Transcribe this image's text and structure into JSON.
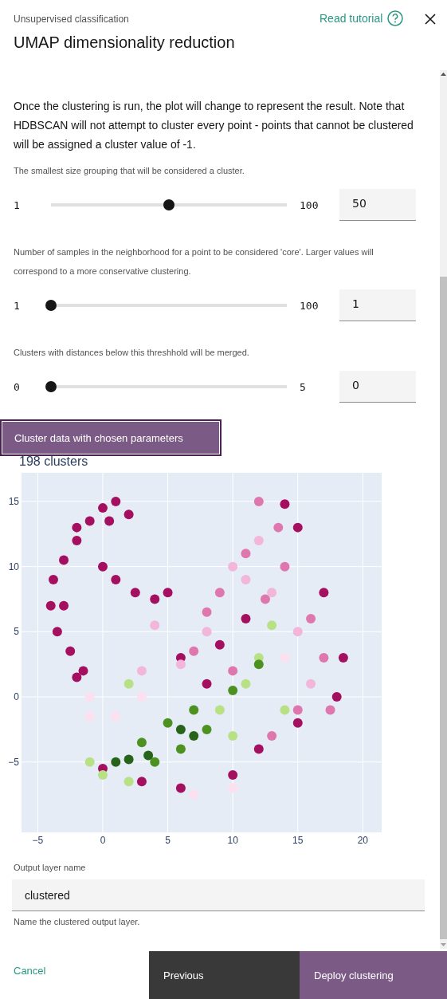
{
  "header": {
    "subtitle": "Unsupervised classification",
    "title": "UMAP dimensionality reduction",
    "tutorial_link": "Read tutorial"
  },
  "intro": "Once the clustering is run, the plot will change to represent the result. Note that HDBSCAN will not attempt to cluster every point - points that cannot be clustered will be assigned a cluster value of -1.",
  "parameters": [
    {
      "description": "The smallest size grouping that will be considered a cluster.",
      "min": "1",
      "max": "100",
      "level": 0.5,
      "value": "50"
    },
    {
      "description": "Number of samples in the neighborhood for a point to be considered 'core'. Larger values will correspond to a more conservative clustering.",
      "min": "1",
      "max": "100",
      "level": 0,
      "value": "1"
    },
    {
      "description": "Clusters with distances below this threshhold will be merged.",
      "min": "0",
      "max": "5",
      "level": 0,
      "value": "0"
    }
  ],
  "cluster_button": "Cluster data with chosen parameters",
  "plot": {
    "chart_data": {
      "type": "scatter",
      "title": "198 clusters",
      "xlim": [
        -6.25,
        21.45
      ],
      "ylim": [
        -10.4,
        17.2
      ],
      "xticks": [
        {
          "value": -5,
          "label": "−5"
        },
        0,
        5,
        10,
        15,
        20
      ],
      "yticks": [
        {
          "value": -5,
          "label": "−5"
        },
        0,
        5,
        10,
        15
      ],
      "grid": true,
      "series": [
        {
          "color": "#a50f5f",
          "x": [
            1,
            0,
            -1,
            -2,
            -3,
            -3.8,
            -4,
            -3.5,
            -2.5,
            -1.5,
            0,
            1,
            2.5,
            4,
            5,
            -2,
            0.5,
            2,
            -3,
            -2,
            6,
            8,
            14,
            15,
            17,
            18.5,
            18,
            10,
            6,
            3,
            0,
            12,
            15,
            9,
            11
          ],
          "values": [
            15,
            14.5,
            13.5,
            12,
            10.5,
            9,
            7,
            5,
            3.5,
            2,
            10,
            9,
            8,
            7.5,
            8,
            13,
            13.5,
            14,
            7,
            1.5,
            3,
            1,
            14.8,
            13,
            8,
            3,
            0,
            -6,
            -7,
            -6.5,
            -5.5,
            -4,
            -2,
            4,
            6
          ]
        },
        {
          "color": "#de77ae",
          "x": [
            12,
            13.5,
            11,
            14,
            16,
            17,
            15,
            13,
            9,
            8,
            7,
            10,
            17.5,
            12.5
          ],
          "values": [
            15,
            13,
            11,
            10,
            6,
            3,
            -1,
            -3,
            8,
            6.5,
            3.5,
            2,
            -1,
            7.5
          ]
        },
        {
          "color": "#f1b6da",
          "x": [
            11,
            13,
            15,
            16,
            8,
            6,
            4,
            10,
            12,
            3
          ],
          "values": [
            9,
            8,
            5,
            1,
            5,
            2.5,
            5.5,
            10,
            12,
            2
          ]
        },
        {
          "color": "#fde0ef",
          "x": [
            -1,
            1,
            3,
            -1,
            14,
            7,
            10
          ],
          "values": [
            -1.5,
            -1.5,
            0,
            0,
            3,
            -7.5,
            -7
          ]
        },
        {
          "color": "#b8e186",
          "x": [
            2,
            13,
            12,
            11,
            9,
            14,
            0,
            -1,
            2,
            10
          ],
          "values": [
            1,
            5.5,
            3,
            1,
            -1,
            -1,
            -6,
            -5,
            -6.5,
            -3
          ]
        },
        {
          "color": "#4d9221",
          "x": [
            5,
            7,
            6,
            8,
            4,
            3,
            10,
            12
          ],
          "values": [
            -2,
            -1,
            -4,
            -2.5,
            -5,
            -3.5,
            0.5,
            2.5
          ]
        },
        {
          "color": "#276419",
          "x": [
            2,
            3.5,
            1,
            6,
            7
          ],
          "values": [
            -4.8,
            -4.5,
            -5,
            -2.5,
            -3
          ]
        }
      ]
    }
  },
  "output_field": {
    "label": "Output layer name",
    "value": "clustered",
    "help": "Name the clustered output layer."
  },
  "footer": {
    "cancel": "Cancel",
    "previous": "Previous",
    "deploy": "Deploy clustering"
  }
}
